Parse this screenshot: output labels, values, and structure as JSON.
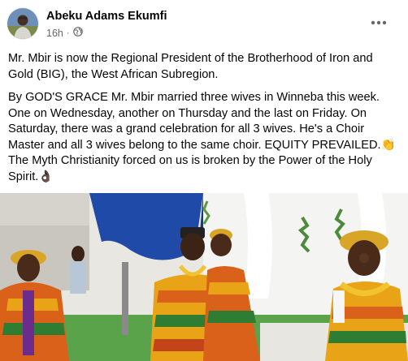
{
  "post": {
    "author": "Abeku Adams Ekumfi",
    "time": "16h",
    "separator": "·",
    "privacy_icon": "globe-icon",
    "more_icon": "more-options-icon",
    "paragraphs": [
      "Mr. Mbir is now the Regional President of the Brotherhood of Iron and Gold (BIG), the West African Subregion.",
      "By GOD'S GRACE Mr. Mbir married three wives in Winneba this week. One on Wednesday, another on Thursday and the last on Friday. On Saturday, there was a grand celebration for all 3 wives. He's a Choir Master and all 3 wives belong to the same choir.  EQUITY PREVAILED.",
      "The Myth Christianity forced on us is broken by the Power of the Holy Spirit."
    ],
    "emoji_1": "👏",
    "emoji_2": "👌🏿",
    "photo_icon": "wedding-photo"
  },
  "colors": {
    "text": "#050505",
    "secondary": "#65676b",
    "kente_gold": "#e8a317",
    "kente_orange": "#d9611a",
    "kente_green": "#2e7d32"
  }
}
